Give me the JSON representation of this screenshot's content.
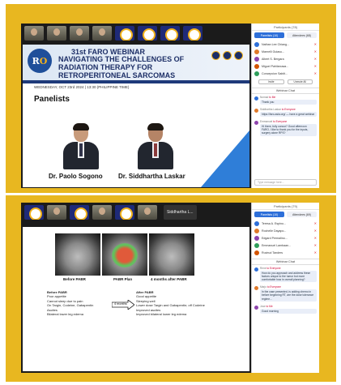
{
  "top": {
    "participants_header": "Participants (78)",
    "tabs": [
      "Panelists (10)",
      "Attendees (68)"
    ],
    "participants": [
      {
        "name": "Nathan Lee Chiang...",
        "color": "#2d6fd9"
      },
      {
        "name": "Marnelli Guiasu...",
        "color": "#e07a2b"
      },
      {
        "name": "Albert S. Bergara",
        "color": "#8e44ad"
      },
      {
        "name": "Miguel Pahilanuwa...",
        "color": "#d35400"
      },
      {
        "name": "Concepcion Sabiit...",
        "color": "#2e9e5b"
      }
    ],
    "buttons": [
      "Invite",
      "Unmute All"
    ],
    "chat_header": "Webinar Chat",
    "messages": [
      {
        "from": "Nomad",
        "to": "to Me",
        "text": "Thank you",
        "color": "#2d6fd9"
      },
      {
        "from": "Siddhartha Laskar",
        "to": "to Everyone",
        "text": "https://faro-asia.org/ — have a great webinar",
        "color": "#e07a2b"
      },
      {
        "from": "Emmanuel",
        "to": "to Everyone",
        "text": "Hi there, fully concur? Good afternoon FARO, I like to thank you for the inputs, surgery alone RPS?",
        "color": "#8e44ad"
      }
    ],
    "chat_placeholder": "Type message here...",
    "slide": {
      "label": "31st FARO WEBINAR",
      "title": "Navigating the Challenges of Radiation Therapy for Retroperitoneal Sarcomas",
      "date": "WEDNESDAY, OCT 23rd 2024 | 13:30 (PHILIPPINE TIME)",
      "panelists_label": "Panelists",
      "panelist_1": "Dr. Paolo Sogono",
      "panelist_2": "Dr. Siddhartha Laskar"
    }
  },
  "bottom": {
    "participants_header": "Participants (79)",
    "tabs": [
      "Panelists (10)",
      "Attendees (69)"
    ],
    "participants": [
      {
        "name": "Teresa A. Espino...",
        "color": "#2d6fd9"
      },
      {
        "name": "Rochelle Dayapo...",
        "color": "#e07a2b"
      },
      {
        "name": "Edgard Permalino...",
        "color": "#8e44ad"
      },
      {
        "name": "Emmanuel Lambaan...",
        "color": "#2e9e5b"
      },
      {
        "name": "Ruvirud Tanders",
        "color": "#d35400"
      }
    ],
    "chat_header": "Webinar Chat",
    "messages": [
      {
        "from": "Rene",
        "to": "to Everyone",
        "text": "How do you approach and address these factors unique to the tumor but more comfortable how in overall planning?",
        "color": "#2d6fd9"
      },
      {
        "from": "Marjo",
        "to": "to Everyone",
        "text": "In the case presented, is adding chemo in before beginning RT, are the dose tolerance regime...",
        "color": "#e07a2b"
      },
      {
        "from": "Jose",
        "to": "to Me",
        "text": "Good morning",
        "color": "#8e44ad"
      }
    ],
    "speaker_name": "Siddhartha L...",
    "slide": {
      "cap_before": "Before PABR",
      "cap_plan": "PABR Plan",
      "cap_after": "4 months after PABR",
      "before_head": "Before PABR",
      "before_items": [
        "Poor appetite",
        "Cannot sleep due to pain",
        "On Targin, Codeine, Gabapentin",
        "Ascites",
        "Bilateral lower leg edema"
      ],
      "arrow_label": "4 months",
      "after_head": "After PABR",
      "after_items": [
        "Good appetite",
        "Sleeping well",
        "Lower dose Targin and Gabapentin; off Codeine",
        "Improved ascites",
        "Improved bilateral lower leg edema"
      ]
    }
  }
}
